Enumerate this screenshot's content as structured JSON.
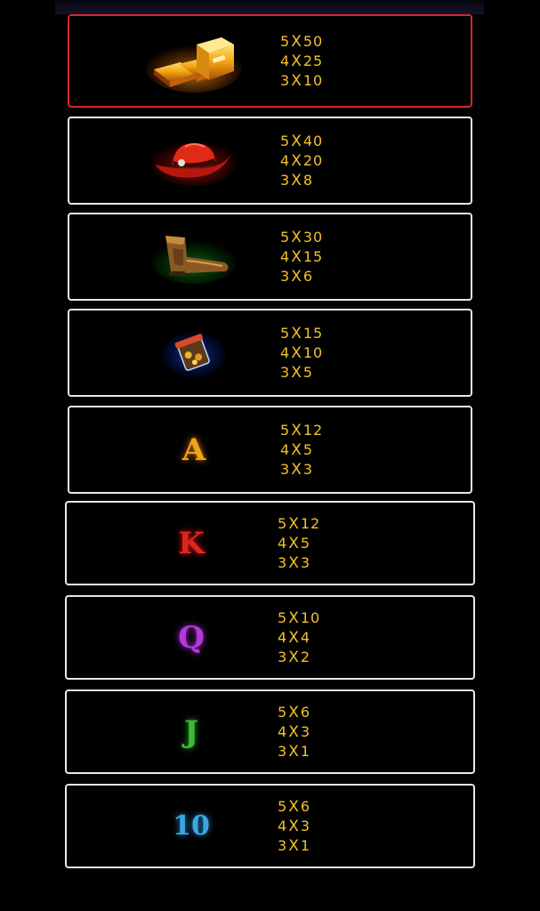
{
  "paytable": [
    {
      "symbol": "gold-bars-icon",
      "pays": [
        {
          "count": "5",
          "mult": "50"
        },
        {
          "count": "4",
          "mult": "25"
        },
        {
          "count": "3",
          "mult": "10"
        }
      ]
    },
    {
      "symbol": "cowboy-hat-icon",
      "pays": [
        {
          "count": "5",
          "mult": "40"
        },
        {
          "count": "4",
          "mult": "20"
        },
        {
          "count": "3",
          "mult": "8"
        }
      ]
    },
    {
      "symbol": "cowboy-boot-icon",
      "pays": [
        {
          "count": "5",
          "mult": "30"
        },
        {
          "count": "4",
          "mult": "15"
        },
        {
          "count": "3",
          "mult": "6"
        }
      ]
    },
    {
      "symbol": "gold-jar-icon",
      "pays": [
        {
          "count": "5",
          "mult": "15"
        },
        {
          "count": "4",
          "mult": "10"
        },
        {
          "count": "3",
          "mult": "5"
        }
      ]
    },
    {
      "symbol": "letter-a-icon",
      "glyph": "A",
      "pays": [
        {
          "count": "5",
          "mult": "12"
        },
        {
          "count": "4",
          "mult": "5"
        },
        {
          "count": "3",
          "mult": "3"
        }
      ]
    },
    {
      "symbol": "letter-k-icon",
      "glyph": "K",
      "pays": [
        {
          "count": "5",
          "mult": "12"
        },
        {
          "count": "4",
          "mult": "5"
        },
        {
          "count": "3",
          "mult": "3"
        }
      ]
    },
    {
      "symbol": "letter-q-icon",
      "glyph": "Q",
      "pays": [
        {
          "count": "5",
          "mult": "10"
        },
        {
          "count": "4",
          "mult": "4"
        },
        {
          "count": "3",
          "mult": "2"
        }
      ]
    },
    {
      "symbol": "letter-j-icon",
      "glyph": "J",
      "pays": [
        {
          "count": "5",
          "mult": "6"
        },
        {
          "count": "4",
          "mult": "3"
        },
        {
          "count": "3",
          "mult": "1"
        }
      ]
    },
    {
      "symbol": "number-10-icon",
      "glyph": "10",
      "pays": [
        {
          "count": "5",
          "mult": "6"
        },
        {
          "count": "4",
          "mult": "3"
        },
        {
          "count": "3",
          "mult": "1"
        }
      ]
    }
  ],
  "times_sign": "X",
  "colors": {
    "text": "#f3c12a",
    "border": "#e8e8e8",
    "selected_border": "#d8262a"
  }
}
